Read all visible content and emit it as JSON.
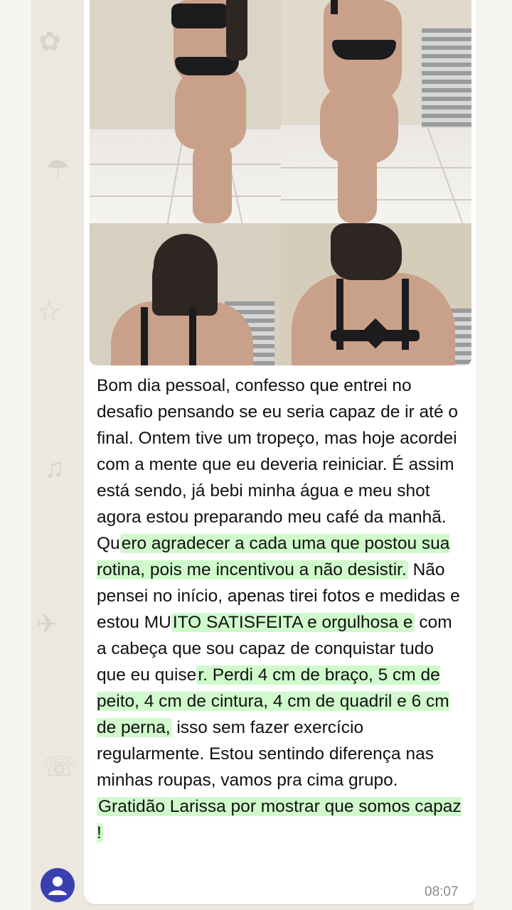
{
  "message": {
    "text_plain_before": "Bom dia pessoal, confesso que entrei no desafio pensando se eu seria capaz de ir até o final. Ontem tive um tropeço, mas hoje acordei com a mente que eu deveria reiniciar. É assim está sendo, já bebi minha água e meu shot agora estou preparando meu café da manhã. Qu",
    "hl1": "ero agradecer a cada uma que postou sua rotina, pois me incentivou a não desistir.",
    "plain2": " Não pensei no início, apenas tirei fotos e medidas e estou MU",
    "hl2": "ITO SATISFEITA e orgulhosa e",
    "plain3": " com a cabeça que sou capaz de conquistar tudo que eu quise",
    "hl3": "r. Perdi 4 cm de braço, 5 cm de peito, 4 cm de cintura, 4 cm de quadril e 6 cm de perna,",
    "plain4": " isso sem fazer exercício regularmente. Estou sentindo diferença nas minhas roupas, vamos pra cima grupo. ",
    "hl4": "Gratidão Larissa por mostrar que somos capaz !",
    "time": "08:07"
  },
  "photos": [
    {
      "name": "photo-side-view-left"
    },
    {
      "name": "photo-side-view-right"
    },
    {
      "name": "photo-back-view-left"
    },
    {
      "name": "photo-back-view-right"
    }
  ],
  "colors": {
    "highlight": "#96f58c",
    "bubble": "#ffffff",
    "wallpaper": "#ece7df",
    "avatar": "#3a3fb0"
  },
  "icons": {
    "avatar": "user-avatar-icon"
  }
}
